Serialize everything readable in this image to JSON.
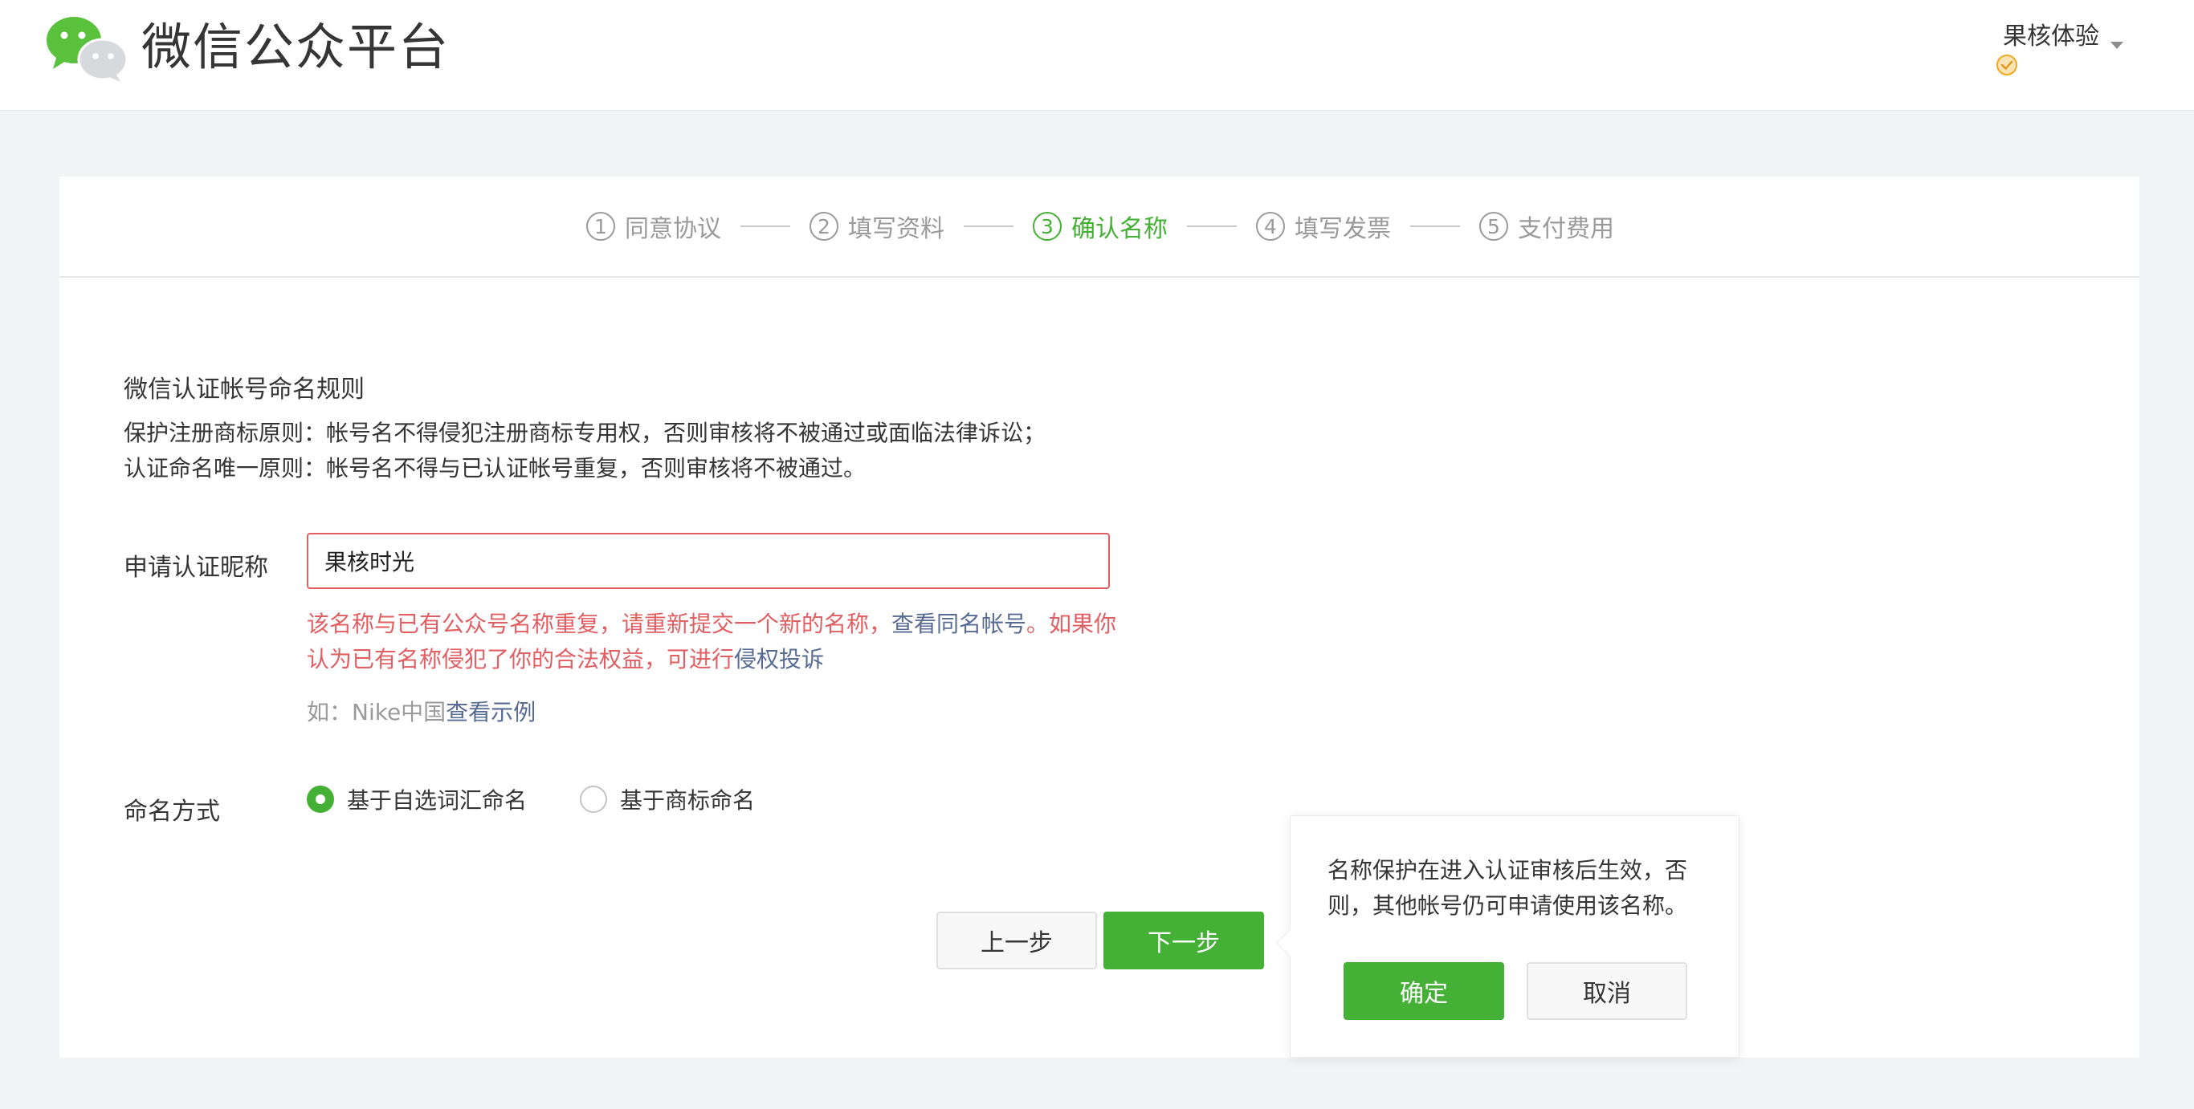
{
  "header": {
    "brand_title": "微信公众平台",
    "account_name": "果核体验",
    "logo_icon": "wechat-logo-icon",
    "verified_icon": "verified-check-icon"
  },
  "steps": [
    {
      "num": "1",
      "label": "同意协议",
      "active": false
    },
    {
      "num": "2",
      "label": "填写资料",
      "active": false
    },
    {
      "num": "3",
      "label": "确认名称",
      "active": true
    },
    {
      "num": "4",
      "label": "填写发票",
      "active": false
    },
    {
      "num": "5",
      "label": "支付费用",
      "active": false
    }
  ],
  "rules": {
    "title": "微信认证帐号命名规则",
    "line1": "保护注册商标原则：帐号名不得侵犯注册商标专用权，否则审核将不被通过或面临法律诉讼；",
    "line2": "认证命名唯一原则：帐号名不得与已认证帐号重复，否则审核将不被通过。"
  },
  "form": {
    "nickname_label": "申请认证昵称",
    "nickname_value": "果核时光",
    "error_part1": "该名称与已有公众号名称重复，请重新提交一个新的名称，",
    "error_link1": "查看同名帐号",
    "error_part2": "。如果你认为已有名称侵犯了你的合法权益，可进行",
    "error_link2": "侵权投诉",
    "example_prefix": "如：Nike中国",
    "example_link": "查看示例",
    "naming_label": "命名方式",
    "naming_options": [
      {
        "label": "基于自选词汇命名",
        "checked": true
      },
      {
        "label": "基于商标命名",
        "checked": false
      }
    ]
  },
  "buttons": {
    "prev": "上一步",
    "next": "下一步"
  },
  "popover": {
    "text": "名称保护在进入认证审核后生效，否则，其他帐号仍可申请使用该名称。",
    "confirm": "确定",
    "cancel": "取消"
  },
  "colors": {
    "accent_green": "#44b035",
    "error_red": "#e15f63",
    "link_blue": "#576b95"
  }
}
